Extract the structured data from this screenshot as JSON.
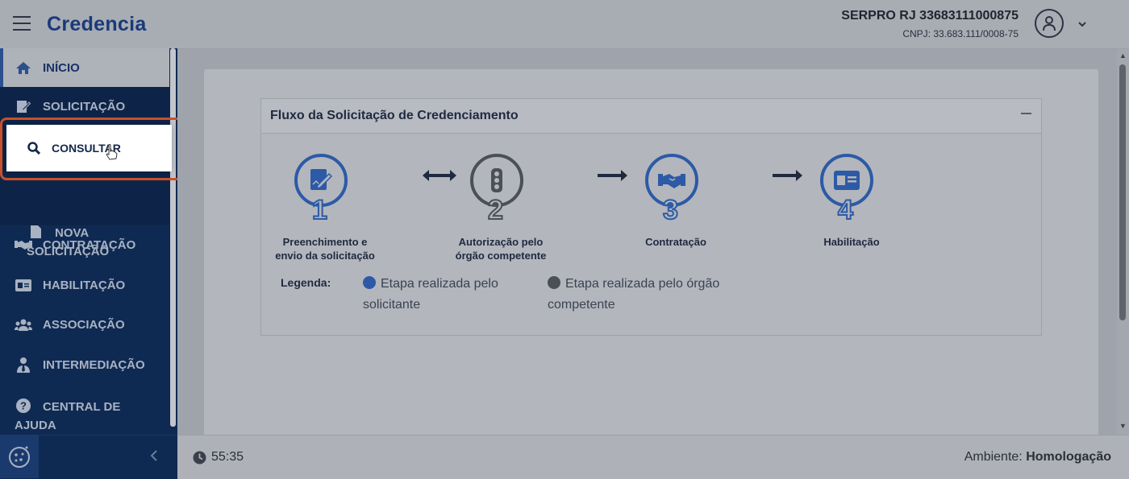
{
  "header": {
    "logo": "Credencia",
    "user_name": "SERPRO RJ 33683111000875",
    "user_cnpj": "CNPJ: 33.683.111/0008-75"
  },
  "sidebar": {
    "items": [
      {
        "label": "INÍCIO",
        "icon": "home-icon"
      },
      {
        "label": "SOLICITAÇÃO",
        "icon": "edit-document-icon"
      },
      {
        "label": "CONSULTAR",
        "icon": "search-icon"
      },
      {
        "label": "NOVA SOLICITAÇÃO",
        "icon": "document-icon"
      },
      {
        "label": "CONTRATAÇÃO",
        "icon": "handshake-icon"
      },
      {
        "label": "HABILITAÇÃO",
        "icon": "id-card-icon"
      },
      {
        "label": "ASSOCIAÇÃO",
        "icon": "users-icon"
      },
      {
        "label": "INTERMEDIAÇÃO",
        "icon": "user-tie-icon"
      },
      {
        "label": "CENTRAL DE AJUDA",
        "icon": "question-circle-icon"
      }
    ]
  },
  "panel": {
    "title": "Fluxo da Solicitação de Credenciamento",
    "steps": [
      {
        "number": "1",
        "label_line1": "Preenchimento e",
        "label_line2": "envio da solicitação",
        "icon": "edit-document-icon",
        "actor": "solicitante"
      },
      {
        "number": "2",
        "label_line1": "Autorização pelo",
        "label_line2": "órgão competente",
        "icon": "traffic-light-icon",
        "actor": "órgão competente"
      },
      {
        "number": "3",
        "label_line1": "Contratação",
        "label_line2": "",
        "icon": "handshake-icon",
        "actor": "solicitante"
      },
      {
        "number": "4",
        "label_line1": "Habilitação",
        "label_line2": "",
        "icon": "id-card-icon",
        "actor": "solicitante"
      }
    ],
    "legend_label": "Legenda:",
    "legend_items": [
      {
        "line1": "Etapa realizada pelo",
        "line2": "solicitante",
        "color": "#2c5aa6"
      },
      {
        "line1": "Etapa realizada pelo órgão",
        "line2": "competente",
        "color": "#4a4f58"
      }
    ]
  },
  "footer": {
    "timer": "55:35",
    "ambiente_label": "Ambiente:",
    "ambiente_value": "Homologação"
  },
  "colors": {
    "brand": "#1a3a7a",
    "sidebar_bg": "#0f2a52",
    "highlight_border": "#c8502a"
  }
}
